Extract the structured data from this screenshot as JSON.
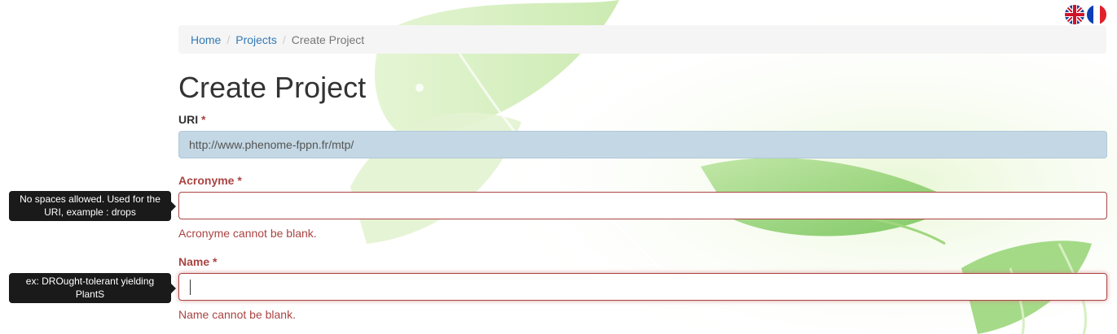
{
  "breadcrumb": {
    "home": "Home",
    "projects": "Projects",
    "current": "Create Project",
    "separator": "/"
  },
  "page_title": "Create Project",
  "language_switch": {
    "english_icon": "uk-flag-icon",
    "french_icon": "france-flag-icon"
  },
  "form": {
    "required_marker": "*",
    "uri": {
      "label": "URI",
      "value": "http://www.phenome-fppn.fr/mtp/"
    },
    "acronyme": {
      "label": "Acronyme",
      "value": "",
      "error": "Acronyme cannot be blank.",
      "tooltip": "No spaces allowed. Used for the URI, example : drops"
    },
    "name": {
      "label": "Name",
      "value": "",
      "error": "Name cannot be blank.",
      "tooltip": "ex: DROught-tolerant yielding PlantS"
    }
  },
  "colors": {
    "link": "#337ab7",
    "error": "#a94442",
    "uri_field_bg": "#c3d7e4",
    "tooltip_bg": "#1a1a1a",
    "breadcrumb_bg": "#f5f5f5"
  }
}
